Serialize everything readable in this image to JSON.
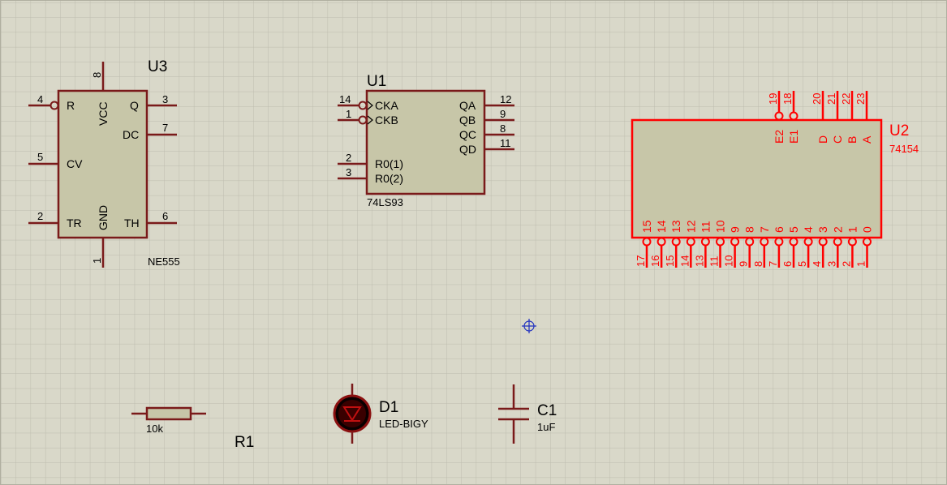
{
  "colors": {
    "background": "#d9d8c9",
    "grid": "#bdbcae",
    "component_fill": "#c7c6a8",
    "component_stroke": "#7a1a1a",
    "selected": "#ff0000",
    "text": "#000000",
    "cursor": "#1f2fbf"
  },
  "u3": {
    "ref": "U3",
    "part": "NE555",
    "pins": {
      "r": {
        "num": "4",
        "name": "R"
      },
      "cv": {
        "num": "5",
        "name": "CV"
      },
      "tr": {
        "num": "2",
        "name": "TR"
      },
      "q": {
        "num": "3",
        "name": "Q"
      },
      "dc": {
        "num": "7",
        "name": "DC"
      },
      "th": {
        "num": "6",
        "name": "TH"
      },
      "vcc": {
        "num": "8",
        "name": "VCC"
      },
      "gnd": {
        "num": "1",
        "name": "GND"
      }
    }
  },
  "u1": {
    "ref": "U1",
    "part": "74LS93",
    "pins": {
      "cka": {
        "num": "14",
        "name": "CKA"
      },
      "ckb": {
        "num": "1",
        "name": "CKB"
      },
      "r01": {
        "num": "2",
        "name": "R0(1)"
      },
      "r02": {
        "num": "3",
        "name": "R0(2)"
      },
      "qa": {
        "num": "12",
        "name": "QA"
      },
      "qb": {
        "num": "9",
        "name": "QB"
      },
      "qc": {
        "num": "8",
        "name": "QC"
      },
      "qd": {
        "num": "11",
        "name": "QD"
      }
    }
  },
  "u2": {
    "ref": "U2",
    "part": "74154",
    "top_pins": [
      {
        "num": "19",
        "name": "E2"
      },
      {
        "num": "18",
        "name": "E1"
      },
      {
        "num": "20",
        "name": "D"
      },
      {
        "num": "21",
        "name": "C"
      },
      {
        "num": "22",
        "name": "B"
      },
      {
        "num": "23",
        "name": "A"
      }
    ],
    "bottom_pins": [
      {
        "num": "17",
        "name": "15"
      },
      {
        "num": "16",
        "name": "14"
      },
      {
        "num": "15",
        "name": "13"
      },
      {
        "num": "14",
        "name": "12"
      },
      {
        "num": "13",
        "name": "11"
      },
      {
        "num": "11",
        "name": "10"
      },
      {
        "num": "10",
        "name": "9"
      },
      {
        "num": "9",
        "name": "8"
      },
      {
        "num": "8",
        "name": "7"
      },
      {
        "num": "7",
        "name": "6"
      },
      {
        "num": "6",
        "name": "5"
      },
      {
        "num": "5",
        "name": "4"
      },
      {
        "num": "4",
        "name": "3"
      },
      {
        "num": "3",
        "name": "2"
      },
      {
        "num": "2",
        "name": "1"
      },
      {
        "num": "1",
        "name": "0"
      }
    ]
  },
  "r1": {
    "ref": "R1",
    "value": "10k"
  },
  "d1": {
    "ref": "D1",
    "value": "LED-BIGY"
  },
  "c1": {
    "ref": "C1",
    "value": "1uF"
  }
}
